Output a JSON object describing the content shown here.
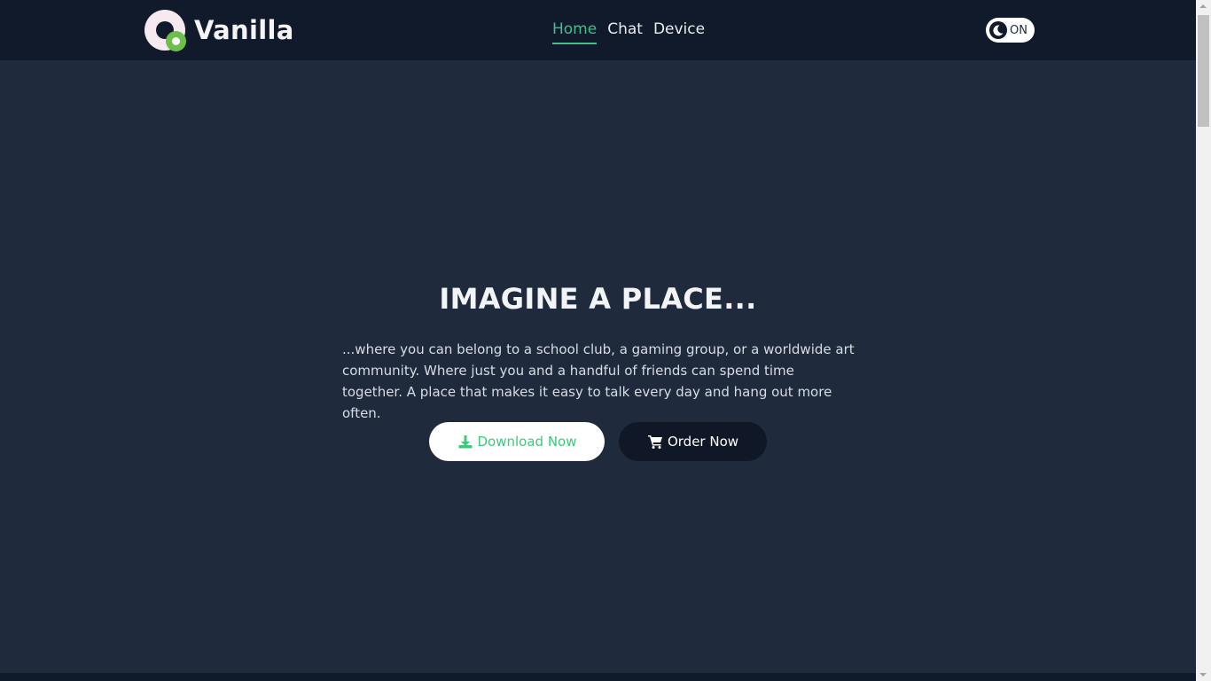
{
  "header": {
    "brand_name": "Vanilla",
    "nav": [
      {
        "label": "Home",
        "active": true
      },
      {
        "label": "Chat",
        "active": false
      },
      {
        "label": "Device",
        "active": false
      }
    ],
    "theme_toggle": {
      "label": "ON",
      "icon": "moon-icon"
    }
  },
  "hero": {
    "title": "IMAGINE A PLACE...",
    "description": "...where you can belong to a school club, a gaming group, or a worldwide art community. Where just you and a handful of friends can spend time together. A place that makes it easy to talk every day and hang out more often.",
    "download_button": {
      "label": "Download Now",
      "icon": "download-icon"
    },
    "order_button": {
      "label": "Order Now",
      "icon": "cart-icon"
    }
  },
  "colors": {
    "background": "#1f2a3c",
    "navbar": "#111a2b",
    "accent": "#3fbf8a",
    "logo_dot": "#6cc04a",
    "download_text": "#3ec87b"
  }
}
